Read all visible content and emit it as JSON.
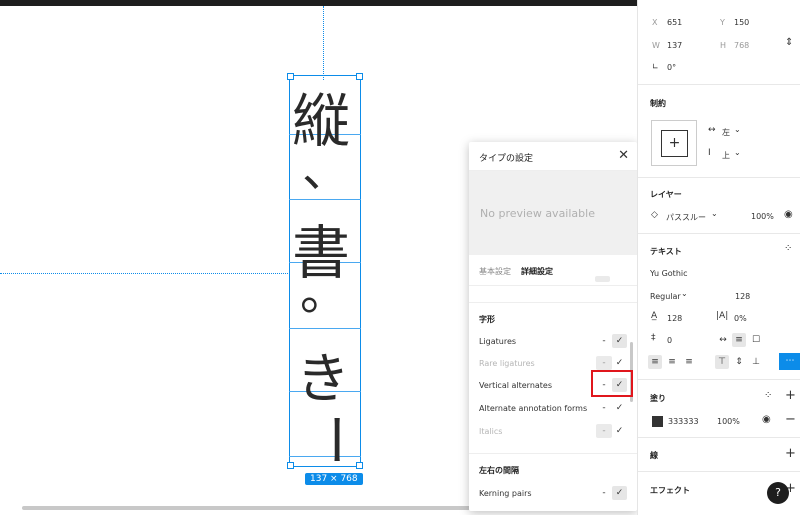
{
  "canvas": {
    "glyphs": [
      "縦",
      "、",
      "書",
      "。",
      "き",
      "ー"
    ],
    "size_badge": "137 × 768"
  },
  "modal": {
    "title": "タイプの設定",
    "close_icon": "close-icon",
    "preview_text": "No preview available",
    "tabs": [
      "基本設定",
      "詳細設定"
    ],
    "section1_title": "字形",
    "rows": [
      {
        "label": "Ligatures",
        "dash": "-",
        "check": "✓",
        "disabled": false
      },
      {
        "label": "Rare ligatures",
        "dash": "-",
        "check": "✓",
        "disabled": true
      },
      {
        "label": "Vertical alternates",
        "dash": "-",
        "check": "✓",
        "disabled": false
      },
      {
        "label": "Alternate annotation forms",
        "dash": "-",
        "check": "✓",
        "disabled": false
      },
      {
        "label": "Italics",
        "dash": "-",
        "check": "✓",
        "disabled": true
      }
    ],
    "section2_title": "左右の間隔",
    "row_kerning": {
      "label": "Kerning pairs",
      "dash": "-",
      "check": "✓"
    }
  },
  "panel": {
    "x_label": "X",
    "x_value": "651",
    "y_label": "Y",
    "y_value": "150",
    "w_label": "W",
    "w_value": "137",
    "h_label": "H",
    "h_value": "768",
    "rotation": "0°",
    "constraints_title": "制約",
    "constraint_h": "左",
    "constraint_v": "上",
    "layer_title": "レイヤー",
    "blend_mode": "パススルー",
    "layer_opacity": "100%",
    "text_title": "テキスト",
    "font_family": "Yu Gothic",
    "font_weight": "Regular",
    "font_size": "128",
    "line_height": "128",
    "letter_spacing": "0%",
    "paragraph_spacing": "0",
    "fill_title": "塗り",
    "fill_hex": "333333",
    "fill_opacity": "100%",
    "stroke_title": "線",
    "effects_title": "エフェクト",
    "help": "?",
    "more": "⋯"
  }
}
